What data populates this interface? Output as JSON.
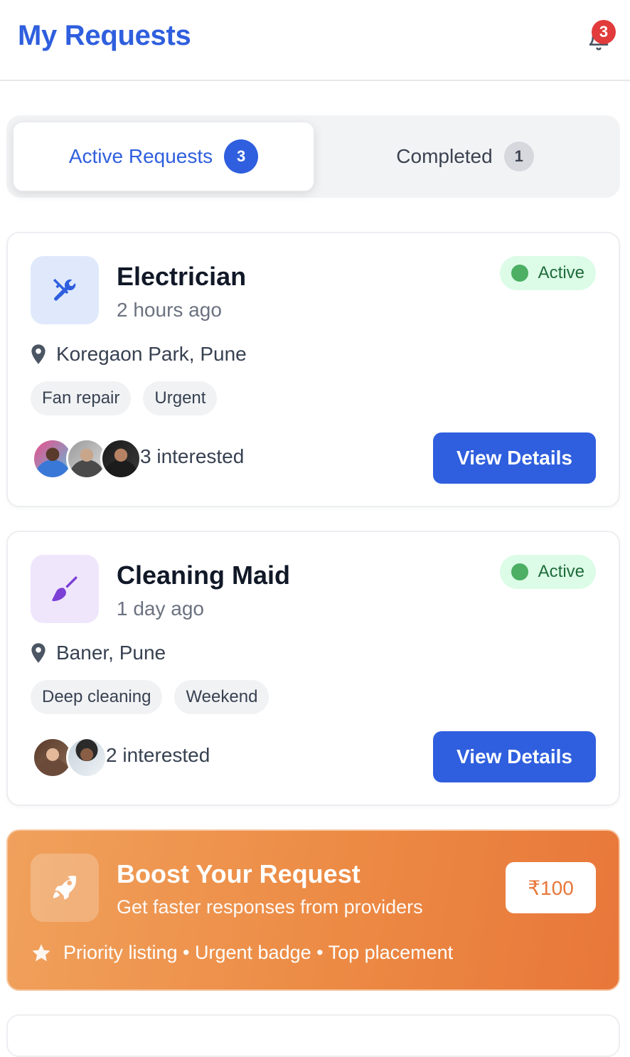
{
  "header": {
    "title": "My Requests",
    "notification_count": "3"
  },
  "tabs": [
    {
      "label": "Active Requests",
      "count": "3"
    },
    {
      "label": "Completed",
      "count": "1"
    }
  ],
  "requests": [
    {
      "title": "Electrician",
      "time": "2 hours ago",
      "status": "Active",
      "location": "Koregaon Park, Pune",
      "tags": [
        "Fan repair",
        "Urgent"
      ],
      "interested": "3 interested",
      "button": "View Details",
      "icon": "tools-icon",
      "icon_bg": "#dfe9fb",
      "icon_color": "#2f5fde"
    },
    {
      "title": "Cleaning Maid",
      "time": "1 day ago",
      "status": "Active",
      "location": "Baner, Pune",
      "tags": [
        "Deep cleaning",
        "Weekend"
      ],
      "interested": "2 interested",
      "button": "View Details",
      "icon": "broom-icon",
      "icon_bg": "#efe6fc",
      "icon_color": "#7c3fd6"
    }
  ],
  "boost": {
    "title": "Boost Your Request",
    "subtitle": "Get faster responses from providers",
    "price": "₹100",
    "perks": "Priority listing • Urgent badge • Top placement",
    "icon": "rocket-icon"
  },
  "colors": {
    "primary": "#2f5fde",
    "active_green": "#4caf63",
    "boost_orange": "#ec8a44",
    "badge_red": "#e23b3b"
  }
}
